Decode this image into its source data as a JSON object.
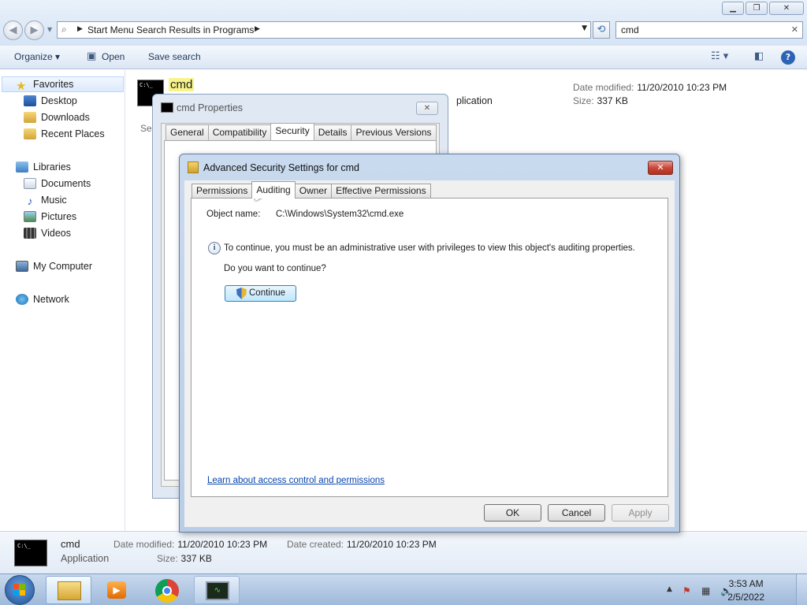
{
  "explorer": {
    "address_path": "Start Menu Search Results in Programs",
    "search_value": "cmd",
    "toolbar": {
      "organize": "Organize",
      "open": "Open",
      "save_search": "Save search"
    },
    "nav": {
      "favorites": "Favorites",
      "desktop": "Desktop",
      "downloads": "Downloads",
      "recent_places": "Recent Places",
      "libraries": "Libraries",
      "documents": "Documents",
      "music": "Music",
      "pictures": "Pictures",
      "videos": "Videos",
      "my_computer": "My Computer",
      "network": "Network"
    },
    "result": {
      "name": "cmd",
      "type_fragment": "plication",
      "date_modified_label": "Date modified:",
      "date_modified": "11/20/2010 10:23 PM",
      "size_label": "Size:",
      "size": "337 KB",
      "search_again_fragment": "Sea"
    },
    "details": {
      "name": "cmd",
      "type": "Application",
      "date_modified_label": "Date modified:",
      "date_modified": "11/20/2010 10:23 PM",
      "date_created_label": "Date created:",
      "date_created": "11/20/2010 10:23 PM",
      "size_label": "Size:",
      "size": "337 KB"
    }
  },
  "props_dialog": {
    "title": "cmd Properties",
    "tabs": [
      "General",
      "Compatibility",
      "Security",
      "Details",
      "Previous Versions"
    ],
    "selected_tab": "Security"
  },
  "adv_dialog": {
    "title": "Advanced Security Settings for cmd",
    "tabs": [
      "Permissions",
      "Auditing",
      "Owner",
      "Effective Permissions"
    ],
    "selected_tab": "Auditing",
    "object_name_label": "Object name:",
    "object_name": "C:\\Windows\\System32\\cmd.exe",
    "info_text": "To continue, you must be an administrative user with privileges to view this object's auditing properties.",
    "ask_text": "Do you want to continue?",
    "continue_label": "Continue",
    "learn_link": "Learn about access control and permissions",
    "buttons": {
      "ok": "OK",
      "cancel": "Cancel",
      "apply": "Apply"
    }
  },
  "taskbar": {
    "time": "3:53 AM",
    "date": "2/5/2022"
  },
  "colors": {
    "highlight": "#f8f48a",
    "link": "#0645ad",
    "close_red": "#c9473a"
  }
}
